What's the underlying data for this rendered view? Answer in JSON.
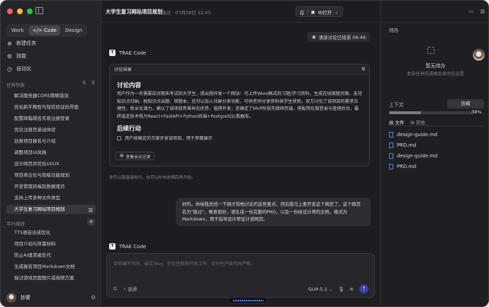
{
  "sidebar": {
    "modes": [
      {
        "label": "Work"
      },
      {
        "label": "</> Code"
      },
      {
        "label": "Design"
      }
    ],
    "nav": [
      {
        "icon": "plus-icon",
        "label": "新建任务"
      },
      {
        "icon": "skill-icon",
        "label": "技能"
      },
      {
        "icon": "auto-icon",
        "label": "自动化"
      }
    ],
    "task_section": "任务列表",
    "tasks": [
      "解决服务器CORS策略错误",
      "优化新手教程与短信验证码界面",
      "配置邮箱域名实现注册登录",
      "优化注册页滚动体验",
      "创意项目报名与介绍",
      "调整项目UI风格",
      "设计网页并优化UI/UX",
      "项目商业化与班级功能规划",
      "开发管理员端及数据埋点",
      "支持上传多种文件类型",
      "大学生复习网站项目规划"
    ],
    "parallel_section": "平行频段",
    "parallel": [
      "TTS语音合成优化",
      "项目介绍与所需材料",
      "防止AI请求被反代",
      "生成报名项目Markdown文档",
      "探讨游戏页面图片或视频方案"
    ],
    "user_name": "妙雾"
  },
  "header": {
    "title": "大学生复习网站项目规划",
    "meta": "隐过 · 07月08日 22:45",
    "open_in_label": "在",
    "open_label": "中打开"
  },
  "chat": {
    "status": "语音讨论已结束 06:49",
    "agent_name": "TRAE Code",
    "card_title": "讨论结果",
    "section1": "讨论内容",
    "section1_text": "用户作为一名需要应对期末考试的大学生，提出想开发一个网站：可上传Word格式的习题/学习资料，生成在线做题页面，支持知识点归纳、按知识点出题、错题本，还可以加入社群分享功能，可供老师分享资料供学生使用。双方讨论了该项目的需求合理性、商业化潜力，确认了该项目有差异化优势，值得开发；还确定了MVP阶段先做网页端，搭配简化版登录与管理后台，最终选定技术栈为React+FastAPI+Python后端+PostgreSQL数据库。",
    "section2": "后续行动",
    "todo": "用户按确定的方案开发该项目，用于参赛展示",
    "view_button": "查看会议记录",
    "note": "你可以我直接执行，也可以补充说明后再开始。",
    "user_message": "好的。你给我总结一下刚才和他讨论的这些要点，然后我马上要开发这个网页了，这个网页名为\"稳过\"，寓意很好。请生成一份完整的PRD，以及一份给设计师的文档，格式为Markdown，用于指导设计师设计该网页。",
    "agent_name2": "TRAE Code"
  },
  "composer": {
    "placeholder": "带你编写代码，调试 Bug，优化性能等开发工作，交付生产级代码产物。",
    "mode_label": "速通",
    "model": "GLM-5.2"
  },
  "panel": {
    "todo_title": "待办",
    "empty_title": "暂无待办",
    "empty_desc": "复杂任务的进展会显示在这里",
    "context_label": "上下文",
    "compress_label": "压缩",
    "context_pct": "38%",
    "context_fraction": 0.38,
    "tabs": [
      "文件",
      "其他"
    ],
    "files": [
      "design-guide.md",
      "PRD.md",
      "design-guide.md",
      "PRD.md"
    ]
  },
  "colors": {
    "accent": "#3b3fa8",
    "file_icon": "#4a8cff",
    "red": "#ff5f57",
    "yellow": "#febc2e",
    "green": "#28c840"
  }
}
